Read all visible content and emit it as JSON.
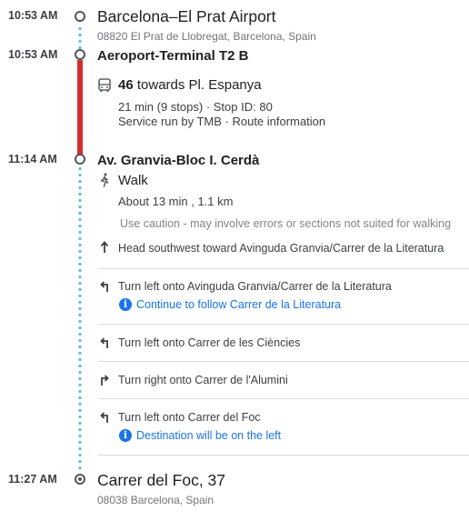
{
  "origin": {
    "time": "10:53 AM",
    "name": "Barcelona–El Prat Airport",
    "address": "08820 El Prat de Llobregat, Barcelona, Spain"
  },
  "bus_stop": {
    "time": "10:53 AM",
    "name": "Aeroport-Terminal T2 B"
  },
  "bus": {
    "icon": "bus-icon",
    "line": "46",
    "headsign": "towards Pl. Espanya",
    "details": "21 min (9 stops) · Stop ID: 80",
    "operator_prefix": "Service run by TMB · ",
    "route_info": "Route information"
  },
  "transfer": {
    "time": "11:14 AM",
    "name": "Av. Granvia-Bloc I. Cerdà"
  },
  "walk": {
    "icon": "walk-icon",
    "label": "Walk",
    "duration": "About 13 min , 1.1 km",
    "caution": "Use caution - may involve errors or sections not suited for walking",
    "steps": [
      {
        "icon": "arrow-up-icon",
        "text": "Head southwest toward Avinguda Granvia/Carrer de la Literatura"
      },
      {
        "icon": "turn-left-icon",
        "text": "Turn left onto Avinguda Granvia/Carrer de la Literatura",
        "note": "Continue to follow Carrer de la Literatura"
      },
      {
        "icon": "turn-left-icon",
        "text": "Turn left onto Carrer de les Ciències"
      },
      {
        "icon": "turn-right-icon",
        "text": "Turn right onto Carrer de l'Alumini"
      },
      {
        "icon": "turn-left-icon",
        "text": "Turn left onto Carrer del Foc",
        "note": "Destination will be on the left"
      }
    ]
  },
  "destination": {
    "time": "11:27 AM",
    "name": "Carrer del Foc, 37",
    "address": "08038 Barcelona, Spain"
  },
  "colors": {
    "bus_line": "#d32f2f",
    "walk_dots": "#4fc3dc",
    "link": "#1a73e8"
  }
}
